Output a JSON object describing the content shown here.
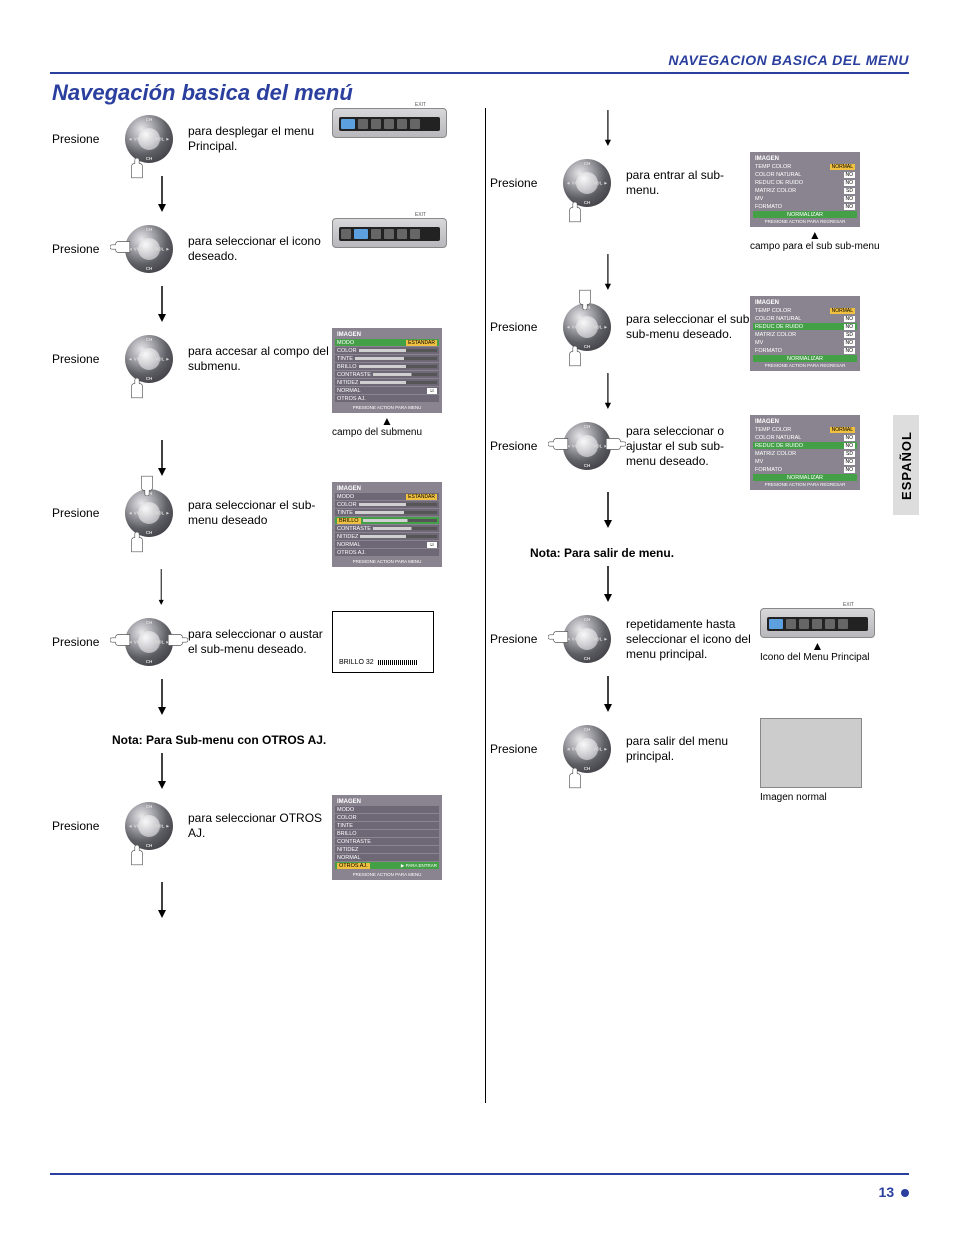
{
  "header": "NAVEGACION BASICA DEL MENU",
  "title": "Navegación basica del menú",
  "side_label": "ESPAÑOL",
  "page_number": "13",
  "press": "Presione",
  "device": {
    "exit": "EXIT"
  },
  "labels": {
    "campo_submenu": "campo del submenu",
    "campo_sub_submenu": "campo para el sub sub-menu",
    "icono_menu_principal": "Icono del Menu Principal",
    "imagen_normal": "Imagen normal",
    "brillo_line": "BRILLO  32"
  },
  "left_steps": [
    {
      "desc": "para desplegar el menu Principal.",
      "hand": "btm"
    },
    {
      "desc": "para seleccionar el icono deseado.",
      "hand": "lft"
    },
    {
      "desc": "para accesar al compo del submenu.",
      "hand": "btm"
    },
    {
      "desc": "para seleccionar el sub-menu deseado",
      "hand": "top"
    },
    {
      "desc": "para seleccionar o austar el sub-menu deseado.",
      "hand": "lft"
    },
    {
      "desc": "para seleccionar OTROS AJ.",
      "hand": "btm"
    }
  ],
  "left_note": "Nota: Para Sub-menu con OTROS AJ.",
  "right_steps": [
    {
      "desc": "para entrar al sub-menu.",
      "hand": "btm"
    },
    {
      "desc": "para seleccionar el sub sub-menu deseado.",
      "hand": "top"
    },
    {
      "desc": "para seleccionar o ajustar el sub sub-menu deseado.",
      "hand": "lft"
    },
    {
      "desc": "repetidamente hasta seleccionar el icono del menu principal.",
      "hand": "lft"
    },
    {
      "desc": "para salir del menu principal.",
      "hand": "btm"
    }
  ],
  "right_note": "Nota: Para salir de menu.",
  "menu_panel": {
    "title": "IMAGEN",
    "rows": [
      {
        "label": "MODO",
        "value": "ESTANDAR",
        "highlight": true
      },
      {
        "label": "COLOR",
        "bar": true
      },
      {
        "label": "TINTE",
        "bar": true
      },
      {
        "label": "BRILLO",
        "bar": true
      },
      {
        "label": "CONTRASTE",
        "bar": true
      },
      {
        "label": "NITIDEZ",
        "bar": true
      },
      {
        "label": "NORMAL",
        "check": true
      },
      {
        "label": "OTROS AJ.",
        "highlight": false
      }
    ],
    "footer": "PRESIONE ACTION PARA MENU"
  },
  "menu_panel_otros": {
    "title": "IMAGEN",
    "rows": [
      {
        "label": "MODO"
      },
      {
        "label": "COLOR"
      },
      {
        "label": "TINTE"
      },
      {
        "label": "BRILLO"
      },
      {
        "label": "CONTRASTE"
      },
      {
        "label": "NITIDEZ"
      },
      {
        "label": "NORMAL"
      },
      {
        "label": "OTROS AJ.",
        "highlight": true,
        "footer": "▶ PARA   ENTRAR"
      }
    ],
    "footer": "PRESIONE ACTION PARA MENU"
  },
  "sub_panel": {
    "title": "IMAGEN",
    "rows": [
      {
        "label": "TEMP COLOR",
        "value": "NORMAL",
        "val_y": true
      },
      {
        "label": "COLOR NATURAL",
        "value": "NO"
      },
      {
        "label": "REDUC DE RUIDO",
        "value": "NO"
      },
      {
        "label": "MATRIZ COLOR",
        "value": "SD"
      },
      {
        "label": "MV",
        "value": "NO"
      },
      {
        "label": "FORMATO",
        "value": "NO"
      }
    ],
    "footer_green": "NORMALIZAR",
    "footer": "PRESIONE ACTION PARA REGRESAR"
  }
}
